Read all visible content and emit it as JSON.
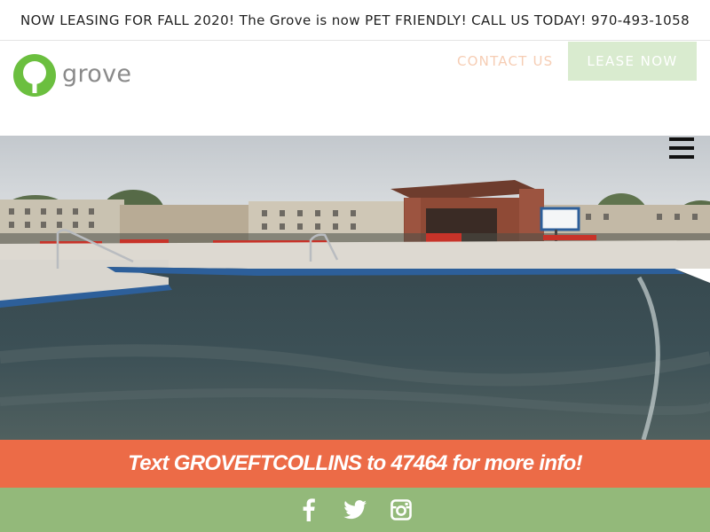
{
  "announcement": {
    "text": "NOW LEASING FOR FALL 2020! The Grove is now PET FRIENDLY! CALL US TODAY! 970-493-1058"
  },
  "header": {
    "logo_text": "grove",
    "contact_label": "CONTACT US",
    "lease_label": "LEASE NOW"
  },
  "hero": {
    "menu_icon": "hamburger-menu-icon",
    "scene": "pool-photo"
  },
  "promo": {
    "text": "Text GROVEFTCOLLINS to 47464 for more info!"
  },
  "social": {
    "icons": [
      "facebook-icon",
      "twitter-icon",
      "instagram-icon"
    ]
  },
  "colors": {
    "brand_green": "#6bbf3f",
    "footer_green": "#93b97a",
    "promo_orange": "#ec6b47",
    "contact_peach": "#f6cdb4",
    "lease_button": "#d9ebcf"
  }
}
